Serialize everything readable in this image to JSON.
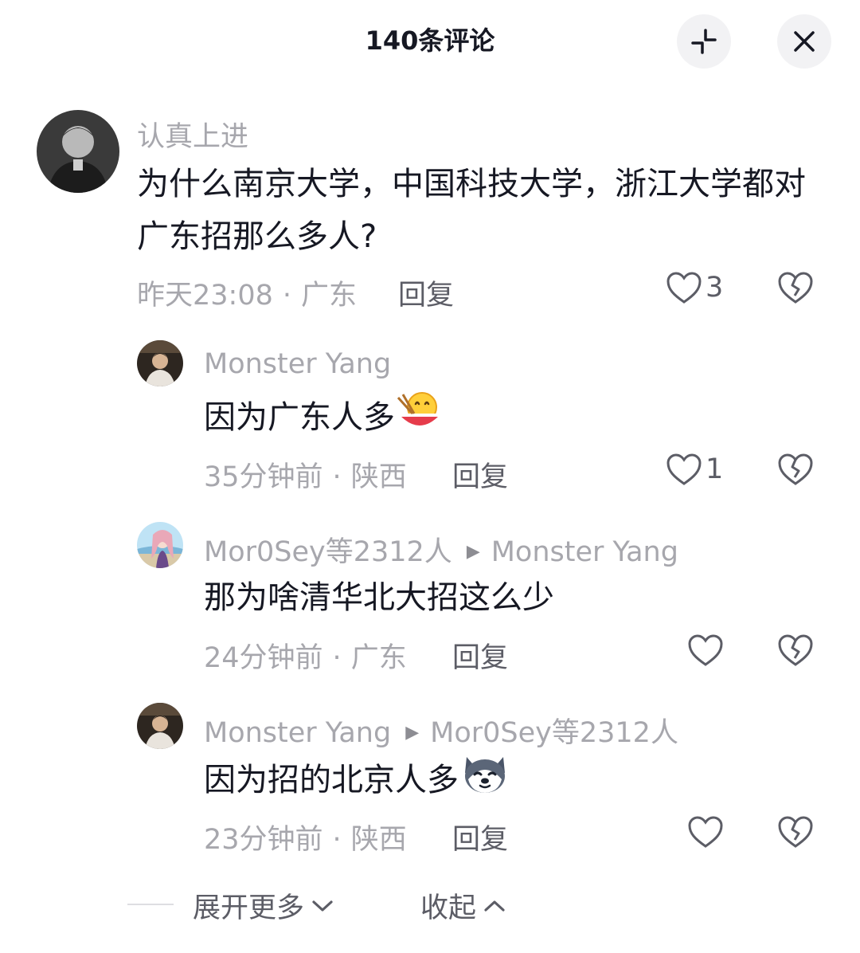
{
  "header": {
    "title": "140条评论",
    "collapse_icon": "collapse-icon",
    "close_icon": "close-icon"
  },
  "comments": [
    {
      "username": "认真上进",
      "content": "为什么南京大学，中国科技大学，浙江大学都对广东招那么多人?",
      "time": "昨天23:08",
      "location": "广东",
      "reply_label": "回复",
      "likes": "3"
    },
    {
      "username": "Monster Yang",
      "content": "因为广东人多",
      "emoji": "eating-noodles-emoji",
      "time": "35分钟前",
      "location": "陕西",
      "reply_label": "回复",
      "likes": "1"
    },
    {
      "username": "Mor0Sey等2312人",
      "reply_to": "Monster Yang",
      "content": "那为啥清华北大招这么少",
      "time": "24分钟前",
      "location": "广东",
      "reply_label": "回复",
      "likes": ""
    },
    {
      "username": "Monster Yang",
      "reply_to": "Mor0Sey等2312人",
      "content": "因为招的北京人多",
      "emoji": "husky-emoji",
      "time": "23分钟前",
      "location": "陕西",
      "reply_label": "回复",
      "likes": ""
    }
  ],
  "footer": {
    "expand_label": "展开更多",
    "collapse_label": "收起"
  },
  "colors": {
    "primary_text": "#161823",
    "secondary_text": "#a7a7ad",
    "action_text": "#5c5d66",
    "button_bg": "#f2f2f4"
  }
}
